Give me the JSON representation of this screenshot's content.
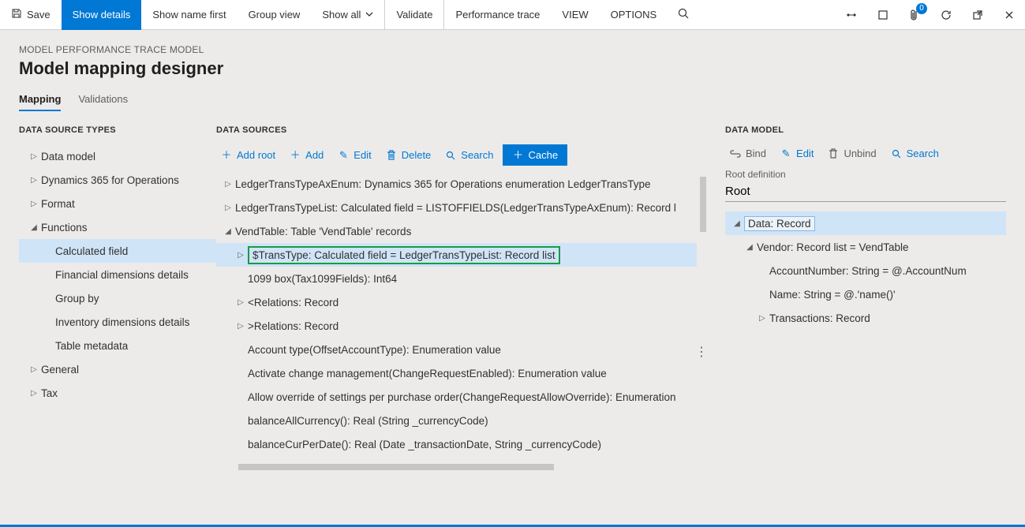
{
  "topbar": {
    "save": "Save",
    "show_details": "Show details",
    "show_name_first": "Show name first",
    "group_view": "Group view",
    "show_all": "Show all",
    "validate": "Validate",
    "perf_trace": "Performance trace",
    "view": "VIEW",
    "options": "OPTIONS",
    "badge_count": "0"
  },
  "breadcrumb": "MODEL PERFORMANCE TRACE MODEL",
  "page_title": "Model mapping designer",
  "tabs": {
    "mapping": "Mapping",
    "validations": "Validations"
  },
  "dst_heading": "DATA SOURCE TYPES",
  "dst_items": [
    "Data model",
    "Dynamics 365 for Operations",
    "Format",
    "Functions",
    "General",
    "Tax"
  ],
  "dst_function_children": [
    "Calculated field",
    "Financial dimensions details",
    "Group by",
    "Inventory dimensions details",
    "Table metadata"
  ],
  "ds_heading": "DATA SOURCES",
  "ds_toolbar": {
    "add_root": "Add root",
    "add": "Add",
    "edit": "Edit",
    "delete": "Delete",
    "search": "Search",
    "cache": "Cache"
  },
  "ds_tree": {
    "row0": "LedgerTransTypeAxEnum: Dynamics 365 for Operations enumeration LedgerTransType",
    "row1": "LedgerTransTypeList: Calculated field = LISTOFFIELDS(LedgerTransTypeAxEnum): Record l",
    "row2": "VendTable: Table 'VendTable' records",
    "row3": "$TransType: Calculated field = LedgerTransTypeList: Record list",
    "row4": "1099 box(Tax1099Fields): Int64",
    "row5": "<Relations: Record",
    "row6": ">Relations: Record",
    "row7": "Account type(OffsetAccountType): Enumeration value",
    "row8": "Activate change management(ChangeRequestEnabled): Enumeration value",
    "row9": "Allow override of settings per purchase order(ChangeRequestAllowOverride): Enumeration",
    "row10": "balanceAllCurrency(): Real (String _currencyCode)",
    "row11": "balanceCurPerDate(): Real (Date _transactionDate, String _currencyCode)"
  },
  "dm_heading": "DATA MODEL",
  "dm_toolbar": {
    "bind": "Bind",
    "edit": "Edit",
    "unbind": "Unbind",
    "search": "Search"
  },
  "dm_root_label": "Root definition",
  "dm_root_value": "Root",
  "dm_tree": {
    "row0": "Data: Record",
    "row1": "Vendor: Record list = VendTable",
    "row2": "AccountNumber: String = @.AccountNum",
    "row3": "Name: String = @.'name()'",
    "row4": "Transactions: Record"
  }
}
